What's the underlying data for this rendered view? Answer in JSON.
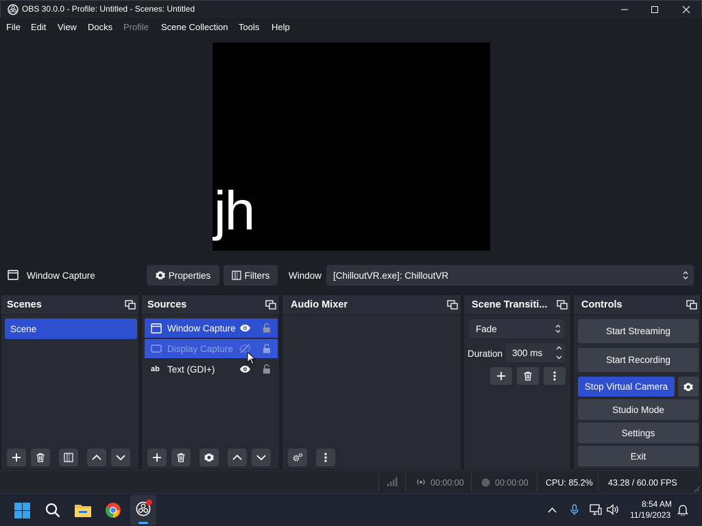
{
  "window": {
    "title": "OBS 30.0.0 - Profile: Untitled - Scenes: Untitled"
  },
  "menu": [
    "File",
    "Edit",
    "View",
    "Docks",
    "Profile",
    "Scene Collection",
    "Tools",
    "Help"
  ],
  "preview": {
    "text": "jh"
  },
  "context_bar": {
    "source_name": "Window Capture",
    "properties_label": "Properties",
    "filters_label": "Filters",
    "window_label": "Window",
    "window_value": "[ChilloutVR.exe]: ChilloutVR"
  },
  "scenes": {
    "title": "Scenes",
    "items": [
      "Scene"
    ]
  },
  "sources": {
    "title": "Sources",
    "items": [
      {
        "name": "Window Capture",
        "visible": true,
        "selected": true
      },
      {
        "name": "Display Capture",
        "visible": false,
        "selected": true
      },
      {
        "name": "Text (GDI+)",
        "visible": true,
        "selected": false
      }
    ]
  },
  "audio_mixer": {
    "title": "Audio Mixer"
  },
  "transitions": {
    "title": "Scene Transiti...",
    "selected": "Fade",
    "duration_label": "Duration",
    "duration_value": "300 ms"
  },
  "controls": {
    "title": "Controls",
    "start_streaming": "Start Streaming",
    "start_recording": "Start Recording",
    "virtual_camera": "Stop Virtual Camera",
    "studio_mode": "Studio Mode",
    "settings": "Settings",
    "exit": "Exit"
  },
  "status": {
    "stream_time": "00:00:00",
    "rec_time": "00:00:00",
    "cpu": "CPU: 85.2%",
    "fps": "43.28 / 60.00 FPS"
  },
  "taskbar": {
    "time": "8:54 AM",
    "date": "11/19/2023"
  },
  "colors": {
    "accent": "#2f4fd1",
    "panel": "#272a33",
    "button": "#3c404b"
  }
}
